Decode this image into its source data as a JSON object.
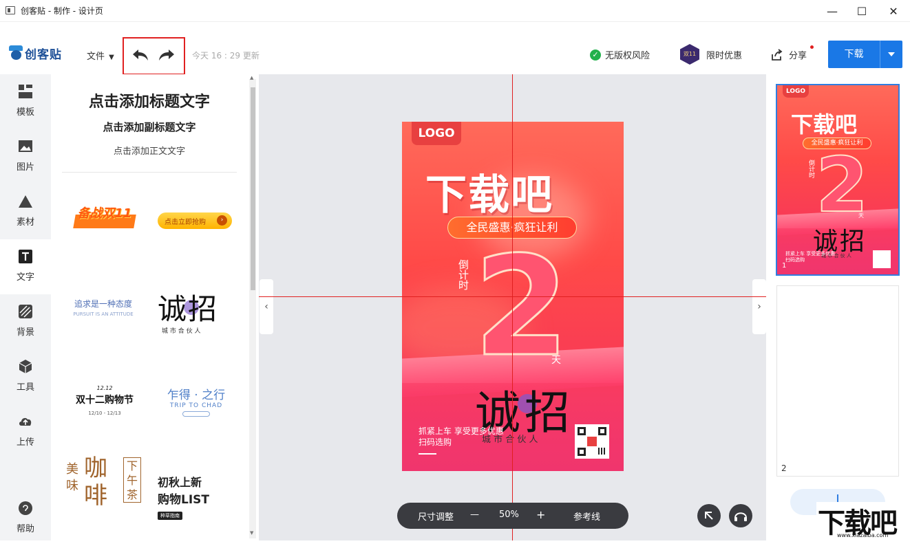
{
  "window": {
    "title": "创客贴 - 制作 - 设计页",
    "minimize": "—",
    "maximize": "☐",
    "close": "✕"
  },
  "toolbar": {
    "logo_text": "创客贴",
    "file_menu": "文件",
    "save_status": "今天 16 : 29 更新",
    "no_copyright_risk": "无版权风险",
    "limited_offer": "限时优惠",
    "limited_badge": "双11",
    "share": "分享",
    "download": "下载"
  },
  "sidebar": {
    "items": [
      {
        "label": "模板",
        "icon": "template-icon"
      },
      {
        "label": "图片",
        "icon": "image-icon"
      },
      {
        "label": "素材",
        "icon": "shapes-icon"
      },
      {
        "label": "文字",
        "icon": "text-icon"
      },
      {
        "label": "背景",
        "icon": "background-icon"
      },
      {
        "label": "工具",
        "icon": "tools-icon"
      },
      {
        "label": "上传",
        "icon": "upload-icon"
      },
      {
        "label": "帮助",
        "icon": "help-icon"
      }
    ]
  },
  "text_panel": {
    "title": "点击添加标题文字",
    "subtitle": "点击添加副标题文字",
    "body": "点击添加正文文字",
    "templates": {
      "t1": "备战双11",
      "t2": "点击立即抢购",
      "t3a": "追求是一种态度",
      "t3b": "PURSUIT IS AN ATTITUDE",
      "t4a": "诚招",
      "t4b": "城 市 合 伙 人",
      "t5a": "12.12",
      "t5b": "双十二购物节",
      "t5c": "12/10 - 12/13",
      "t6a": "乍得 · 之行",
      "t6b": "TRIP TO CHAD",
      "t7a": "美味",
      "t7b": "咖啡",
      "t7c": "下午茶",
      "t8a": "初秋上新",
      "t8b": "购物LIST",
      "t8c": "种草指南"
    }
  },
  "poster": {
    "logo": "LOGO",
    "headline": "下载吧",
    "pill": "全民盛惠·疯狂让利",
    "countdown_label": "倒计时",
    "number": "2",
    "unit": "天",
    "recruit": "诚招",
    "recruit_sub": "城 市 合 伙 人",
    "footer_line1": "抓紧上车 享受更多优惠",
    "footer_line2": "扫码选购"
  },
  "zoombar": {
    "size_adjust": "尺寸调整",
    "minus": "—",
    "zoom": "50%",
    "plus": "+",
    "guides": "参考线"
  },
  "pages": {
    "page1_num": "1",
    "page2_num": "2"
  },
  "watermark": {
    "text": "下载吧",
    "url": "www.xiazaiba.com"
  },
  "colors": {
    "accent": "#1a78e6",
    "guide": "#e02020",
    "poster_red": "#ff4a48"
  }
}
